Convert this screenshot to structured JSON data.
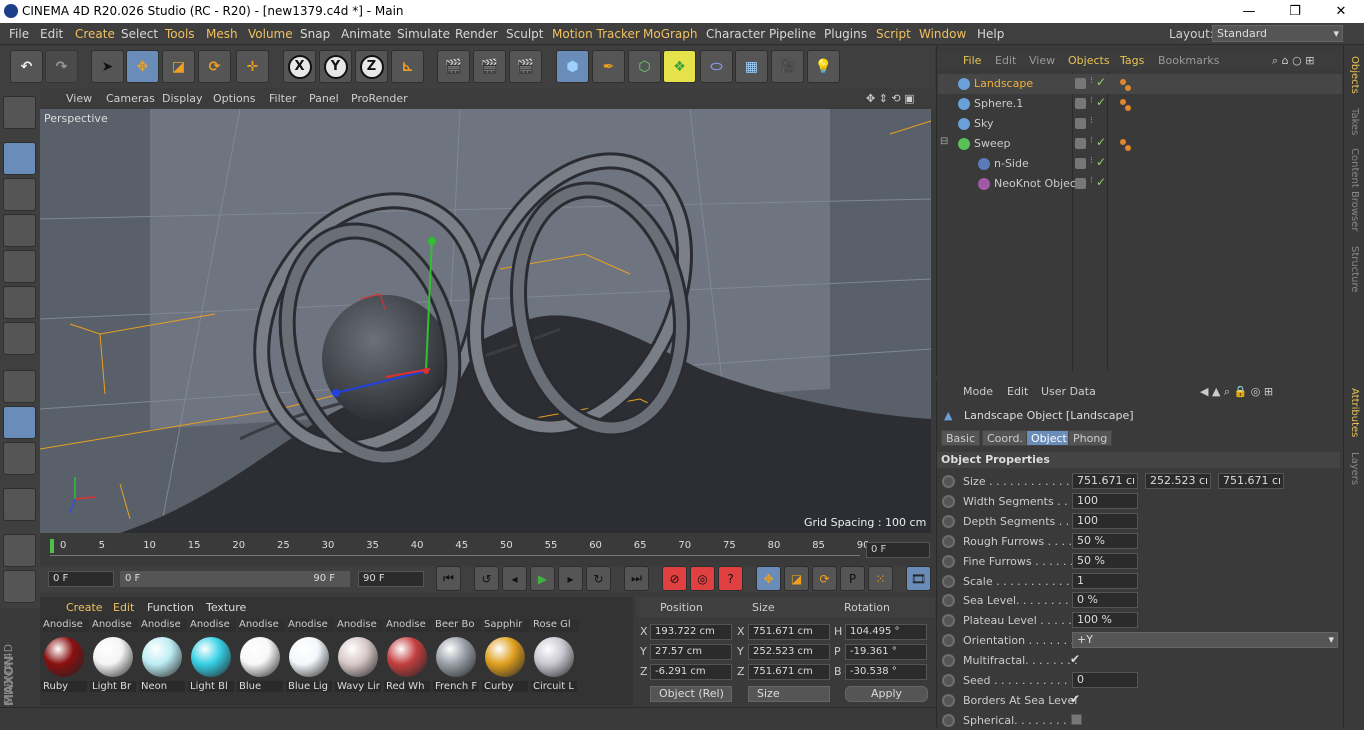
{
  "window": {
    "title": "CINEMA 4D R20.026 Studio (RC - R20) - [new1379.c4d *] - Main",
    "minimize": "—",
    "maximize": "❐",
    "close": "✕"
  },
  "menu": {
    "items": [
      "File",
      "Edit",
      "Create",
      "Select",
      "Tools",
      "Mesh",
      "Volume",
      "Snap",
      "Animate",
      "Simulate",
      "Render",
      "Sculpt",
      "Motion Tracker",
      "MoGraph",
      "Character",
      "Pipeline",
      "Plugins",
      "Script",
      "Window",
      "Help"
    ],
    "layout_label": "Layout:",
    "layout_value": "Standard"
  },
  "toolbar": {
    "x": "X",
    "y": "Y",
    "z": "Z"
  },
  "viewport": {
    "menu": [
      "View",
      "Cameras",
      "Display",
      "Options",
      "Filter",
      "Panel",
      "ProRender"
    ],
    "camera": "Perspective",
    "grid_spacing": "Grid Spacing : 100 cm"
  },
  "timeline": {
    "ticks": [
      "0",
      "5",
      "10",
      "15",
      "20",
      "25",
      "30",
      "35",
      "40",
      "45",
      "50",
      "55",
      "60",
      "65",
      "70",
      "75",
      "80",
      "85",
      "90"
    ],
    "current_frame": "0 F"
  },
  "playback": {
    "start": "0 F",
    "range_start": "0 F",
    "range_end": "90 F",
    "end": "90 F"
  },
  "materials": {
    "menu": [
      "Create",
      "Edit",
      "Function",
      "Texture"
    ],
    "top_names": [
      "Anodise",
      "Anodise",
      "Anodise",
      "Anodise",
      "Anodise",
      "Anodise",
      "Anodise",
      "Anodise",
      "Beer Bo",
      "Sapphir",
      "Rose Gl"
    ],
    "items": [
      {
        "name": "Ruby",
        "color": "#8a1010"
      },
      {
        "name": "Light Br",
        "color": "#f4f4f4"
      },
      {
        "name": "Neon",
        "color": "#bdeef4"
      },
      {
        "name": "Light Bl",
        "color": "#37d0e6"
      },
      {
        "name": "Blue",
        "color": "#f8f8f8"
      },
      {
        "name": "Blue Lig",
        "color": "#f4f8fc"
      },
      {
        "name": "Wavy Lir",
        "color": "#d8c8c8"
      },
      {
        "name": "Red Wh",
        "color": "#c44040"
      },
      {
        "name": "French F",
        "color": "#9aa0a8"
      },
      {
        "name": "Curby",
        "color": "#e0a020"
      },
      {
        "name": "Circuit L",
        "color": "#c8c8d0"
      }
    ]
  },
  "coords": {
    "headers": [
      "Position",
      "Size",
      "Rotation"
    ],
    "rows": [
      {
        "axis": "X",
        "pos": "193.722 cm",
        "size_axis": "X",
        "size": "751.671 cm",
        "rot_axis": "H",
        "rot": "104.495 °"
      },
      {
        "axis": "Y",
        "pos": "27.57 cm",
        "size_axis": "Y",
        "size": "252.523 cm",
        "rot_axis": "P",
        "rot": "-19.361 °"
      },
      {
        "axis": "Z",
        "pos": "-6.291 cm",
        "size_axis": "Z",
        "size": "751.671 cm",
        "rot_axis": "B",
        "rot": "-30.538 °"
      }
    ],
    "mode": "Object (Rel)",
    "size_mode": "Size",
    "apply": "Apply"
  },
  "objects": {
    "menu": [
      "File",
      "Edit",
      "View",
      "Objects",
      "Tags",
      "Bookmarks"
    ],
    "list": [
      {
        "name": "Landscape",
        "selected": true,
        "indent": 0,
        "color": "#6aa0d8",
        "check": true,
        "tags": true
      },
      {
        "name": "Sphere.1",
        "selected": false,
        "indent": 0,
        "color": "#6aa0d8",
        "check": true,
        "tags": true
      },
      {
        "name": "Sky",
        "selected": false,
        "indent": 0,
        "color": "#6aa0d8",
        "check": false,
        "tags": false
      },
      {
        "name": "Sweep",
        "selected": false,
        "indent": 0,
        "color": "#58c058",
        "check": true,
        "tags": true
      },
      {
        "name": "n-Side",
        "selected": false,
        "indent": 1,
        "color": "#5a7ab8",
        "check": true,
        "tags": false
      },
      {
        "name": "NeoKnot Object",
        "selected": false,
        "indent": 1,
        "color": "#a05aa8",
        "check": true,
        "tags": false
      }
    ]
  },
  "side_tabs_top": [
    "Objects",
    "Takes",
    "Content Browser",
    "Structure"
  ],
  "side_tabs_bottom": [
    "Attributes",
    "Layers"
  ],
  "attributes": {
    "menu": [
      "Mode",
      "Edit",
      "User Data"
    ],
    "title": "Landscape Object [Landscape]",
    "tabs": [
      "Basic",
      "Coord.",
      "Object",
      "Phong"
    ],
    "active_tab": "Object",
    "section": "Object Properties",
    "props": [
      {
        "label": "Size . . . . . . . . . . . . . .",
        "values": [
          "751.671 cı",
          "252.523 cı",
          "751.671 cı"
        ]
      },
      {
        "label": "Width Segments . . .",
        "values": [
          "100"
        ]
      },
      {
        "label": "Depth Segments . . .",
        "values": [
          "100"
        ]
      },
      {
        "label": "Rough Furrows . . . .",
        "values": [
          "50 %"
        ]
      },
      {
        "label": "Fine Furrows . . . . . .",
        "values": [
          "50 %"
        ]
      },
      {
        "label": "Scale . . . . . . . . . . . . .",
        "values": [
          "1"
        ]
      },
      {
        "label": "Sea Level. . . . . . . . . .",
        "values": [
          "0 %"
        ]
      },
      {
        "label": "Plateau Level . . . . . .",
        "values": [
          "100 %"
        ]
      },
      {
        "label": "Orientation . . . . . . . .",
        "values": [
          "+Y"
        ]
      },
      {
        "label": "Multifractal. . . . . . . .",
        "check": true
      },
      {
        "label": "Seed . . . . . . . . . . . . .",
        "values": [
          "0"
        ]
      },
      {
        "label": "Borders At Sea Level",
        "check": true
      },
      {
        "label": "Spherical. . . . . . . . . .",
        "check": false
      }
    ]
  },
  "branding": {
    "maxon": "MAXON",
    "cinema": "CINEMA 4D"
  }
}
